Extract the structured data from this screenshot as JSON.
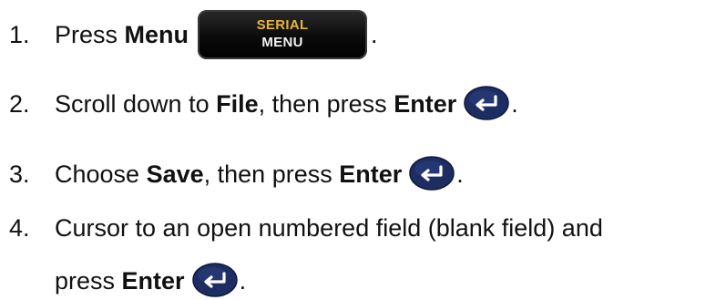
{
  "steps": [
    {
      "number": "1.",
      "parts": [
        "Press ",
        "Menu",
        "."
      ],
      "key": {
        "type": "serial-menu",
        "line1": "SERIAL",
        "line2": "MENU",
        "line1_color": "#e8b43c",
        "line2_color": "#f1f1f1"
      }
    },
    {
      "number": "2.",
      "parts": [
        "Scroll down to ",
        "File",
        ", then press ",
        "Enter",
        "."
      ],
      "key": {
        "type": "enter",
        "icon": "enter-arrow-icon",
        "color": "#1d2d62"
      }
    },
    {
      "number": "3.",
      "parts": [
        "Choose ",
        "Save",
        ", then press ",
        "Enter",
        "."
      ],
      "key": {
        "type": "enter",
        "icon": "enter-arrow-icon",
        "color": "#1d2d62"
      }
    },
    {
      "number": "4.",
      "parts": [
        "Cursor to an open numbered field (blank field) and",
        "press ",
        "Enter",
        "."
      ],
      "key": {
        "type": "enter",
        "icon": "enter-arrow-icon",
        "color": "#1d2d62"
      }
    }
  ]
}
